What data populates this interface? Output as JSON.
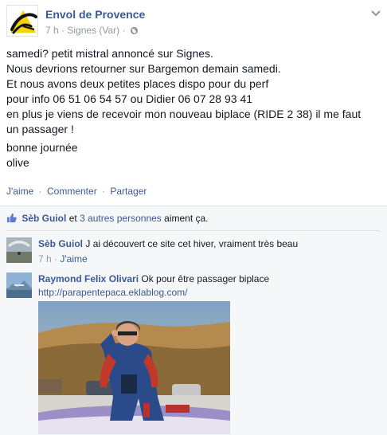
{
  "post": {
    "page_name": "Envol de Provence",
    "time": "7 h",
    "location": "Signes (Var)",
    "meta_separator": "·",
    "globe_icon": "globe-icon",
    "body_lines": [
      "samedi? petit mistral annoncé sur Signes.",
      "Nous devrions retourner sur Bargemon demain samedi.",
      "Et nous avons deux petites places dispo pour du perf",
      "pour info 06 51 06 54 57 ou Didier 06 07 28 93 41",
      "en plus je viens de recevoir mon nouveau biplace (RIDE 2 38) il me faut",
      "un passager !"
    ],
    "closing_lines": [
      "bonne journée",
      "olive"
    ],
    "actions": {
      "like": "J'aime",
      "comment": "Commenter",
      "share": "Partager",
      "separator": "·"
    }
  },
  "likes": {
    "thumb_icon": "thumb-up-icon",
    "first_name": "Sèb Guiol",
    "connector": "et",
    "others": "3 autres personnes",
    "suffix": "aiment ça."
  },
  "comments": [
    {
      "author": "Sèb Guiol",
      "text": "J ai découvert ce site cet hiver, vraiment très beau",
      "time": "7 h",
      "separator": "·",
      "like": "J'aime"
    },
    {
      "author": "Raymond Felix Olivari",
      "text": "Ok pour être passager biplace",
      "url": "http://parapentepaca.eklablog.com/"
    }
  ],
  "colors": {
    "link": "#3b5998",
    "meta": "#9197a3",
    "text": "#141823",
    "feedback_bg": "#f6f7f8",
    "logo_yellow": "#f2d400"
  }
}
